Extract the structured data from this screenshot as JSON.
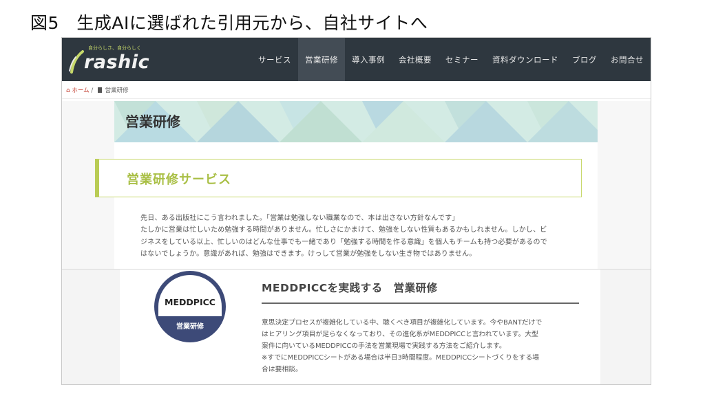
{
  "slide": {
    "title": "図5　生成AIに選ばれた引用元から、自社サイトへ"
  },
  "header": {
    "logo_tagline": "自分らしさ、自分らしく",
    "logo_text": "rashic",
    "nav": [
      "サービス",
      "営業研修",
      "導入事例",
      "会社概要",
      "セミナー",
      "資料ダウンロード",
      "ブログ",
      "お問合せ"
    ],
    "active_nav": "営業研修"
  },
  "breadcrumb": {
    "home": "ホーム",
    "separator": "/",
    "current": "営業研修"
  },
  "hero": {
    "title": "営業研修"
  },
  "section": {
    "title": "営業研修サービス"
  },
  "intro": {
    "lines": [
      "先日、ある出版社にこう言われました。「営業は勉強しない職業なので、本は出さない方針なんです」",
      "たしかに営業は忙しいため勉強する時間がありません。忙しさにかまけて、勉強をしない性質もあるかもしれません。しかし、ビ",
      "ジネスをしている以上、忙しいのはどんな仕事でも一緒であり「勉強する時間を作る意識」を個人もチームも持つ必要があるので",
      "はないでしょうか。意識があれば、勉強はできます。けっして営業が勉強をしない生き物ではありません。"
    ]
  },
  "course": {
    "badge_label": "MEDDPICC",
    "badge_sub": "営業研修",
    "title": "MEDDPICCを実践する　営業研修",
    "lines": [
      "意思決定プロセスが複雑化している中、聴くべき項目が複雑化しています。今やBANTだけで",
      "はヒアリング項目が足らなくなっており、その進化系がMEDDPICCと言われています。大型",
      "案件に向いているMEDDPICCの手法を営業現場で実践する方法をご紹介します。",
      "※すでにMEDDPICCシートがある場合は半日3時間程度。MEDDPICCシートづくりをする場",
      "合は要相談。"
    ]
  },
  "colors": {
    "header_bg": "#2e373f",
    "accent_green": "#b9cc55",
    "badge_navy": "#3d4a78",
    "breadcrumb_red": "#c0392b"
  }
}
